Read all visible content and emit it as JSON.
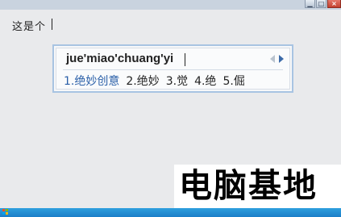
{
  "window": {
    "controls": {
      "minimize": "▁",
      "maximize": "□",
      "close": "×"
    }
  },
  "document": {
    "text": "这是个"
  },
  "ime": {
    "pinyin": "jue'miao'chuang'yi",
    "candidates": [
      {
        "label": "1.绝妙创意",
        "selected": true
      },
      {
        "label": "2.绝妙",
        "selected": false
      },
      {
        "label": "3.觉",
        "selected": false
      },
      {
        "label": "4.绝",
        "selected": false
      },
      {
        "label": "5.倔",
        "selected": false
      }
    ],
    "nav_icons": [
      "prev-page-icon",
      "next-page-icon"
    ],
    "colors": {
      "selected_candidate": "#2a5fa8",
      "border": "#a8c4e2"
    }
  },
  "watermark": {
    "text": "电脑基地"
  },
  "taskbar": {
    "start_icon": "windows-logo-icon"
  }
}
